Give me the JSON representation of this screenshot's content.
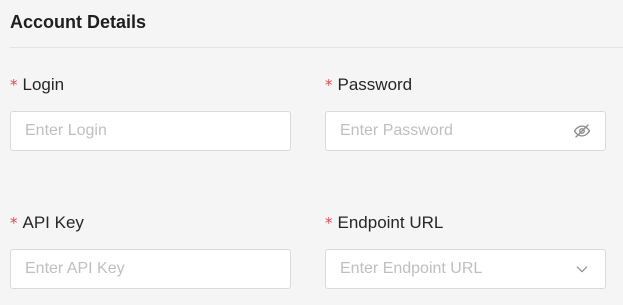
{
  "section": {
    "title": "Account Details"
  },
  "fields": {
    "login": {
      "required_mark": "*",
      "label": "Login",
      "placeholder": "Enter Login",
      "value": ""
    },
    "password": {
      "required_mark": "*",
      "label": "Password",
      "placeholder": "Enter Password",
      "value": "",
      "toggle_icon": "eye-off-icon"
    },
    "api_key": {
      "required_mark": "*",
      "label": "API Key",
      "placeholder": "Enter API Key",
      "value": ""
    },
    "endpoint_url": {
      "required_mark": "*",
      "label": "Endpoint URL",
      "placeholder": "Enter Endpoint URL",
      "dropdown_icon": "chevron-down-icon"
    }
  },
  "colors": {
    "required": "#e5484d",
    "placeholder": "#bfbfbf",
    "border": "#d9d9d9",
    "background": "#f5f5f5"
  }
}
